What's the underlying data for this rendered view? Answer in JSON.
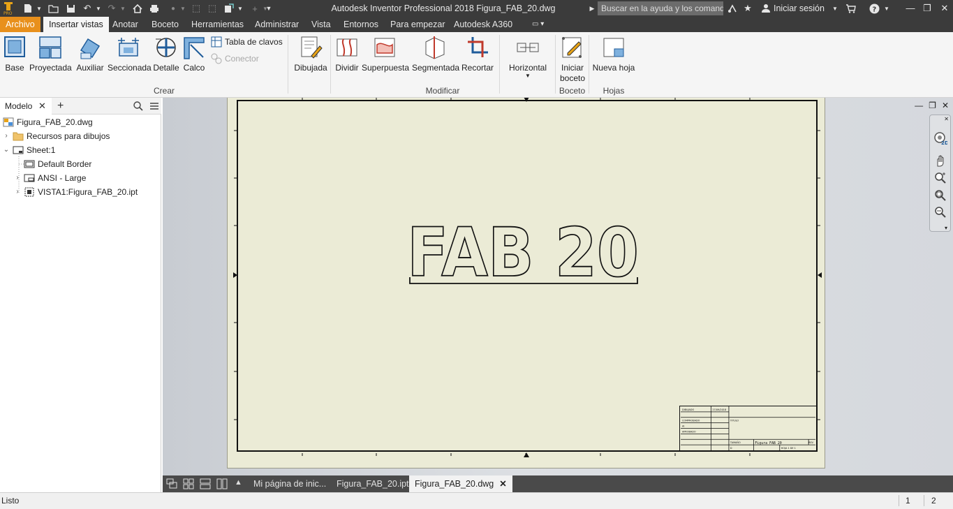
{
  "app": {
    "title": "Autodesk Inventor Professional 2018   Figura_FAB_20.dwg",
    "search_placeholder": "Buscar en la ayuda y los comandos",
    "signin_label": "Iniciar sesión"
  },
  "menu": {
    "file": "Archivo",
    "tabs": [
      "Insertar vistas",
      "Anotar",
      "Boceto",
      "Herramientas",
      "Administrar",
      "Vista",
      "Entornos",
      "Para empezar",
      "Autodesk A360"
    ]
  },
  "ribbon": {
    "create": {
      "label": "Crear",
      "buttons": [
        "Base",
        "Proyectada",
        "Auxiliar",
        "Seccionada",
        "Detalle",
        "Calco"
      ],
      "small": [
        "Tabla de clavos",
        "Conector"
      ]
    },
    "modify": {
      "label": "Modificar",
      "buttons": [
        "Dibujada",
        "Dividir",
        "Superpuesta",
        "Segmentada",
        "Recortar",
        "Horizontal"
      ]
    },
    "sketch": {
      "label": "Boceto",
      "button_line1": "Iniciar",
      "button_line2": "boceto"
    },
    "sheets": {
      "label": "Hojas",
      "button": "Nueva hoja"
    }
  },
  "browser": {
    "tab": "Modelo",
    "tree": [
      "Figura_FAB_20.dwg",
      "Recursos para dibujos",
      "Sheet:1",
      "Default Border",
      "ANSI - Large",
      "VISTA1:Figura_FAB_20.ipt"
    ]
  },
  "drawing": {
    "text": "FAB 20",
    "titleblock_text": "Figura FAB 20"
  },
  "doc_tabs": [
    "Mi página de inic...",
    "Figura_FAB_20.ipt",
    "Figura_FAB_20.dwg"
  ],
  "status": {
    "text": "Listo",
    "num1": "1",
    "num2": "2"
  },
  "colors": {
    "file_tab": "#e8901c",
    "sheet": "#ebebd6",
    "titlebar": "#3b3b3b"
  }
}
